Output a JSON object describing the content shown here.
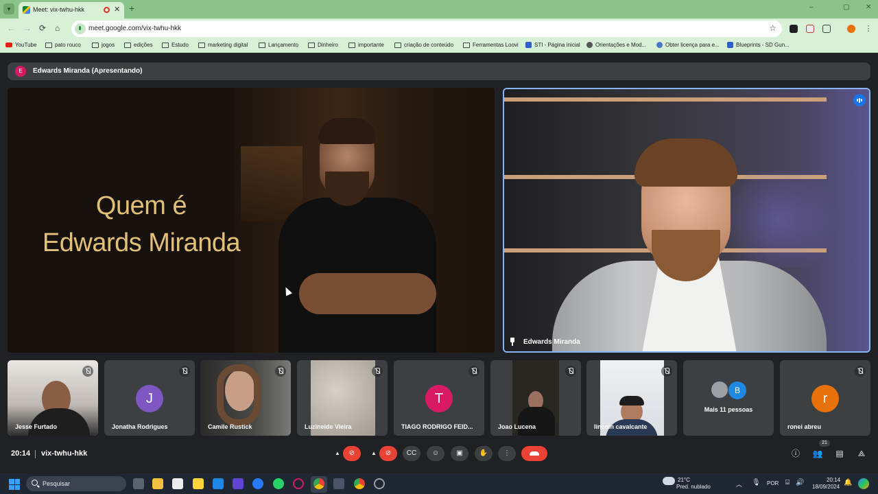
{
  "browser": {
    "tab_title": "Meet: vix-twhu-hkk",
    "tab_close": "✕",
    "new_tab": "+",
    "url": "meet.google.com/vix-twhu-hkk",
    "window_controls": [
      "–",
      "▢",
      "✕"
    ],
    "nav": [
      "←",
      "→",
      "⟳",
      "⌂"
    ],
    "star": "☆",
    "bookmarks": [
      {
        "label": "YouTube",
        "icon": "youtube-icon"
      },
      {
        "label": "pato rouco",
        "icon": "folder-icon"
      },
      {
        "label": "jogos",
        "icon": "folder-icon"
      },
      {
        "label": "edições",
        "icon": "folder-icon"
      },
      {
        "label": "Estudo",
        "icon": "folder-icon"
      },
      {
        "label": "marketing digital",
        "icon": "folder-icon"
      },
      {
        "label": "Lançamento",
        "icon": "folder-icon"
      },
      {
        "label": "Dinheiro",
        "icon": "folder-icon"
      },
      {
        "label": "importante",
        "icon": "folder-icon"
      },
      {
        "label": "criação de conteúdo",
        "icon": "folder-icon"
      },
      {
        "label": "Ferramentas Loovi",
        "icon": "folder-icon"
      },
      {
        "label": "STI - Página inicial",
        "icon": "site-icon"
      },
      {
        "label": "Orientações e Mod...",
        "icon": "site-icon"
      },
      {
        "label": "Obter licença para e...",
        "icon": "site-icon"
      },
      {
        "label": "Blueprints - SD Gun...",
        "icon": "site-icon"
      }
    ]
  },
  "meet": {
    "presenter_initial": "E",
    "presenter_label": "Edwards Miranda (Apresentando)",
    "slide_title_line1": "Quem é",
    "slide_title_line2": "Edwards Miranda",
    "speaker_name": "Edwards Miranda",
    "participants": [
      {
        "name": "Jesse Furtado",
        "type": "video"
      },
      {
        "name": "Jonatha Rodrigues",
        "type": "avatar",
        "initial": "J",
        "color": "#7e57c2"
      },
      {
        "name": "Camile Rustick",
        "type": "video"
      },
      {
        "name": "Luzineide Vieira",
        "type": "video"
      },
      {
        "name": "TIAGO RODRIGO FEID...",
        "type": "avatar",
        "initial": "T",
        "color": "#d81b60"
      },
      {
        "name": "Joao Lucena",
        "type": "video"
      },
      {
        "name": "lincoln cavalcante",
        "type": "video"
      },
      {
        "name": "Mais 11 pessoas",
        "type": "more",
        "initial": "B",
        "color": "#1e88e5"
      },
      {
        "name": "ronei abreu",
        "type": "avatar",
        "initial": "r",
        "color": "#e8710a"
      }
    ],
    "time": "20:14",
    "meeting_code": "vix-twhu-hkk",
    "people_count": "21"
  },
  "taskbar": {
    "search_placeholder": "Pesquisar",
    "weather_temp": "21°C",
    "weather_desc": "Pred. nublado",
    "language": "POR",
    "time": "20:14",
    "date": "18/09/2024"
  },
  "colors": {
    "accent": "#8ab4f8",
    "danger": "#ea4335",
    "slide_gold": "#e3c077"
  }
}
